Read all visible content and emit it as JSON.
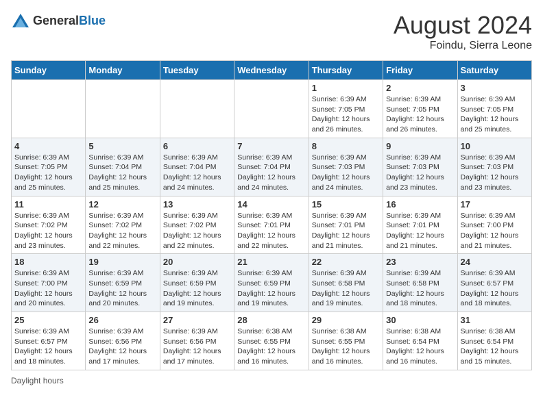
{
  "logo": {
    "general": "General",
    "blue": "Blue"
  },
  "title": "August 2024",
  "location": "Foindu, Sierra Leone",
  "days_of_week": [
    "Sunday",
    "Monday",
    "Tuesday",
    "Wednesday",
    "Thursday",
    "Friday",
    "Saturday"
  ],
  "footer_label": "Daylight hours",
  "weeks": [
    [
      {
        "day": "",
        "info": ""
      },
      {
        "day": "",
        "info": ""
      },
      {
        "day": "",
        "info": ""
      },
      {
        "day": "",
        "info": ""
      },
      {
        "day": "1",
        "info": "Sunrise: 6:39 AM\nSunset: 7:05 PM\nDaylight: 12 hours and 26 minutes."
      },
      {
        "day": "2",
        "info": "Sunrise: 6:39 AM\nSunset: 7:05 PM\nDaylight: 12 hours and 26 minutes."
      },
      {
        "day": "3",
        "info": "Sunrise: 6:39 AM\nSunset: 7:05 PM\nDaylight: 12 hours and 25 minutes."
      }
    ],
    [
      {
        "day": "4",
        "info": "Sunrise: 6:39 AM\nSunset: 7:05 PM\nDaylight: 12 hours and 25 minutes."
      },
      {
        "day": "5",
        "info": "Sunrise: 6:39 AM\nSunset: 7:04 PM\nDaylight: 12 hours and 25 minutes."
      },
      {
        "day": "6",
        "info": "Sunrise: 6:39 AM\nSunset: 7:04 PM\nDaylight: 12 hours and 24 minutes."
      },
      {
        "day": "7",
        "info": "Sunrise: 6:39 AM\nSunset: 7:04 PM\nDaylight: 12 hours and 24 minutes."
      },
      {
        "day": "8",
        "info": "Sunrise: 6:39 AM\nSunset: 7:03 PM\nDaylight: 12 hours and 24 minutes."
      },
      {
        "day": "9",
        "info": "Sunrise: 6:39 AM\nSunset: 7:03 PM\nDaylight: 12 hours and 23 minutes."
      },
      {
        "day": "10",
        "info": "Sunrise: 6:39 AM\nSunset: 7:03 PM\nDaylight: 12 hours and 23 minutes."
      }
    ],
    [
      {
        "day": "11",
        "info": "Sunrise: 6:39 AM\nSunset: 7:02 PM\nDaylight: 12 hours and 23 minutes."
      },
      {
        "day": "12",
        "info": "Sunrise: 6:39 AM\nSunset: 7:02 PM\nDaylight: 12 hours and 22 minutes."
      },
      {
        "day": "13",
        "info": "Sunrise: 6:39 AM\nSunset: 7:02 PM\nDaylight: 12 hours and 22 minutes."
      },
      {
        "day": "14",
        "info": "Sunrise: 6:39 AM\nSunset: 7:01 PM\nDaylight: 12 hours and 22 minutes."
      },
      {
        "day": "15",
        "info": "Sunrise: 6:39 AM\nSunset: 7:01 PM\nDaylight: 12 hours and 21 minutes."
      },
      {
        "day": "16",
        "info": "Sunrise: 6:39 AM\nSunset: 7:01 PM\nDaylight: 12 hours and 21 minutes."
      },
      {
        "day": "17",
        "info": "Sunrise: 6:39 AM\nSunset: 7:00 PM\nDaylight: 12 hours and 21 minutes."
      }
    ],
    [
      {
        "day": "18",
        "info": "Sunrise: 6:39 AM\nSunset: 7:00 PM\nDaylight: 12 hours and 20 minutes."
      },
      {
        "day": "19",
        "info": "Sunrise: 6:39 AM\nSunset: 6:59 PM\nDaylight: 12 hours and 20 minutes."
      },
      {
        "day": "20",
        "info": "Sunrise: 6:39 AM\nSunset: 6:59 PM\nDaylight: 12 hours and 19 minutes."
      },
      {
        "day": "21",
        "info": "Sunrise: 6:39 AM\nSunset: 6:59 PM\nDaylight: 12 hours and 19 minutes."
      },
      {
        "day": "22",
        "info": "Sunrise: 6:39 AM\nSunset: 6:58 PM\nDaylight: 12 hours and 19 minutes."
      },
      {
        "day": "23",
        "info": "Sunrise: 6:39 AM\nSunset: 6:58 PM\nDaylight: 12 hours and 18 minutes."
      },
      {
        "day": "24",
        "info": "Sunrise: 6:39 AM\nSunset: 6:57 PM\nDaylight: 12 hours and 18 minutes."
      }
    ],
    [
      {
        "day": "25",
        "info": "Sunrise: 6:39 AM\nSunset: 6:57 PM\nDaylight: 12 hours and 18 minutes."
      },
      {
        "day": "26",
        "info": "Sunrise: 6:39 AM\nSunset: 6:56 PM\nDaylight: 12 hours and 17 minutes."
      },
      {
        "day": "27",
        "info": "Sunrise: 6:39 AM\nSunset: 6:56 PM\nDaylight: 12 hours and 17 minutes."
      },
      {
        "day": "28",
        "info": "Sunrise: 6:38 AM\nSunset: 6:55 PM\nDaylight: 12 hours and 16 minutes."
      },
      {
        "day": "29",
        "info": "Sunrise: 6:38 AM\nSunset: 6:55 PM\nDaylight: 12 hours and 16 minutes."
      },
      {
        "day": "30",
        "info": "Sunrise: 6:38 AM\nSunset: 6:54 PM\nDaylight: 12 hours and 16 minutes."
      },
      {
        "day": "31",
        "info": "Sunrise: 6:38 AM\nSunset: 6:54 PM\nDaylight: 12 hours and 15 minutes."
      }
    ]
  ]
}
